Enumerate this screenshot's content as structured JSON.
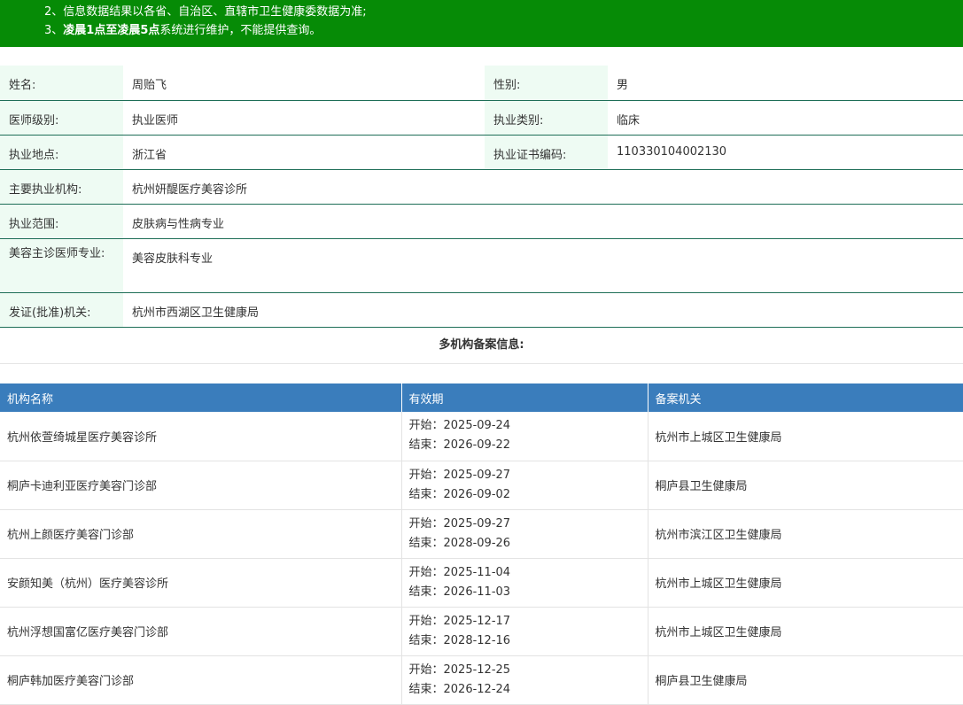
{
  "notice": {
    "line2": "2、信息数据结果以各省、自治区、直辖市卫生健康委数据为准;",
    "line3_prefix": "3、",
    "line3_bold": "凌晨1点至凌晨5点",
    "line3_suffix": "系统进行维护，不能提供查询。"
  },
  "info": {
    "name_label": "姓名:",
    "name": "周贻飞",
    "gender_label": "性别:",
    "gender": "男",
    "level_label": "医师级别:",
    "level": "执业医师",
    "category_label": "执业类别:",
    "category": "临床",
    "location_label": "执业地点:",
    "location": "浙江省",
    "cert_label": "执业证书编码:",
    "cert": "110330104002130",
    "org_label": "主要执业机构:",
    "org": "杭州妍醍医疗美容诊所",
    "scope_label": "执业范围:",
    "scope": "皮肤病与性病专业",
    "cosmetic_label": "美容主诊医师专业:",
    "cosmetic": "美容皮肤科专业",
    "authority_label": "发证(批准)机关:",
    "authority": "杭州市西湖区卫生健康局"
  },
  "multi": {
    "title": "多机构备案信息:",
    "headers": [
      "机构名称",
      "有效期",
      "备案机关"
    ],
    "rows": [
      {
        "name": "杭州依萱绮城星医疗美容诊所",
        "start": "开始：2025-09-24",
        "end": "结束：2026-09-22",
        "authority": "杭州市上城区卫生健康局"
      },
      {
        "name": "桐庐卡迪利亚医疗美容门诊部",
        "start": "开始：2025-09-27",
        "end": "结束：2026-09-02",
        "authority": "桐庐县卫生健康局"
      },
      {
        "name": "杭州上颜医疗美容门诊部",
        "start": "开始：2025-09-27",
        "end": "结束：2028-09-26",
        "authority": "杭州市滨江区卫生健康局"
      },
      {
        "name": "安颜知美（杭州）医疗美容诊所",
        "start": "开始：2025-11-04",
        "end": "结束：2026-11-03",
        "authority": "杭州市上城区卫生健康局"
      },
      {
        "name": "杭州浮想国富亿医疗美容门诊部",
        "start": "开始：2025-12-17",
        "end": "结束：2028-12-16",
        "authority": "杭州市上城区卫生健康局"
      },
      {
        "name": "桐庐韩加医疗美容门诊部",
        "start": "开始：2025-12-25",
        "end": "结束：2026-12-24",
        "authority": "桐庐县卫生健康局"
      }
    ]
  },
  "colors": {
    "notice_bg": "#068b06",
    "label_bg": "#eefbf3",
    "header_bg": "#3a7dbc",
    "row_border": "#1e6e57"
  }
}
